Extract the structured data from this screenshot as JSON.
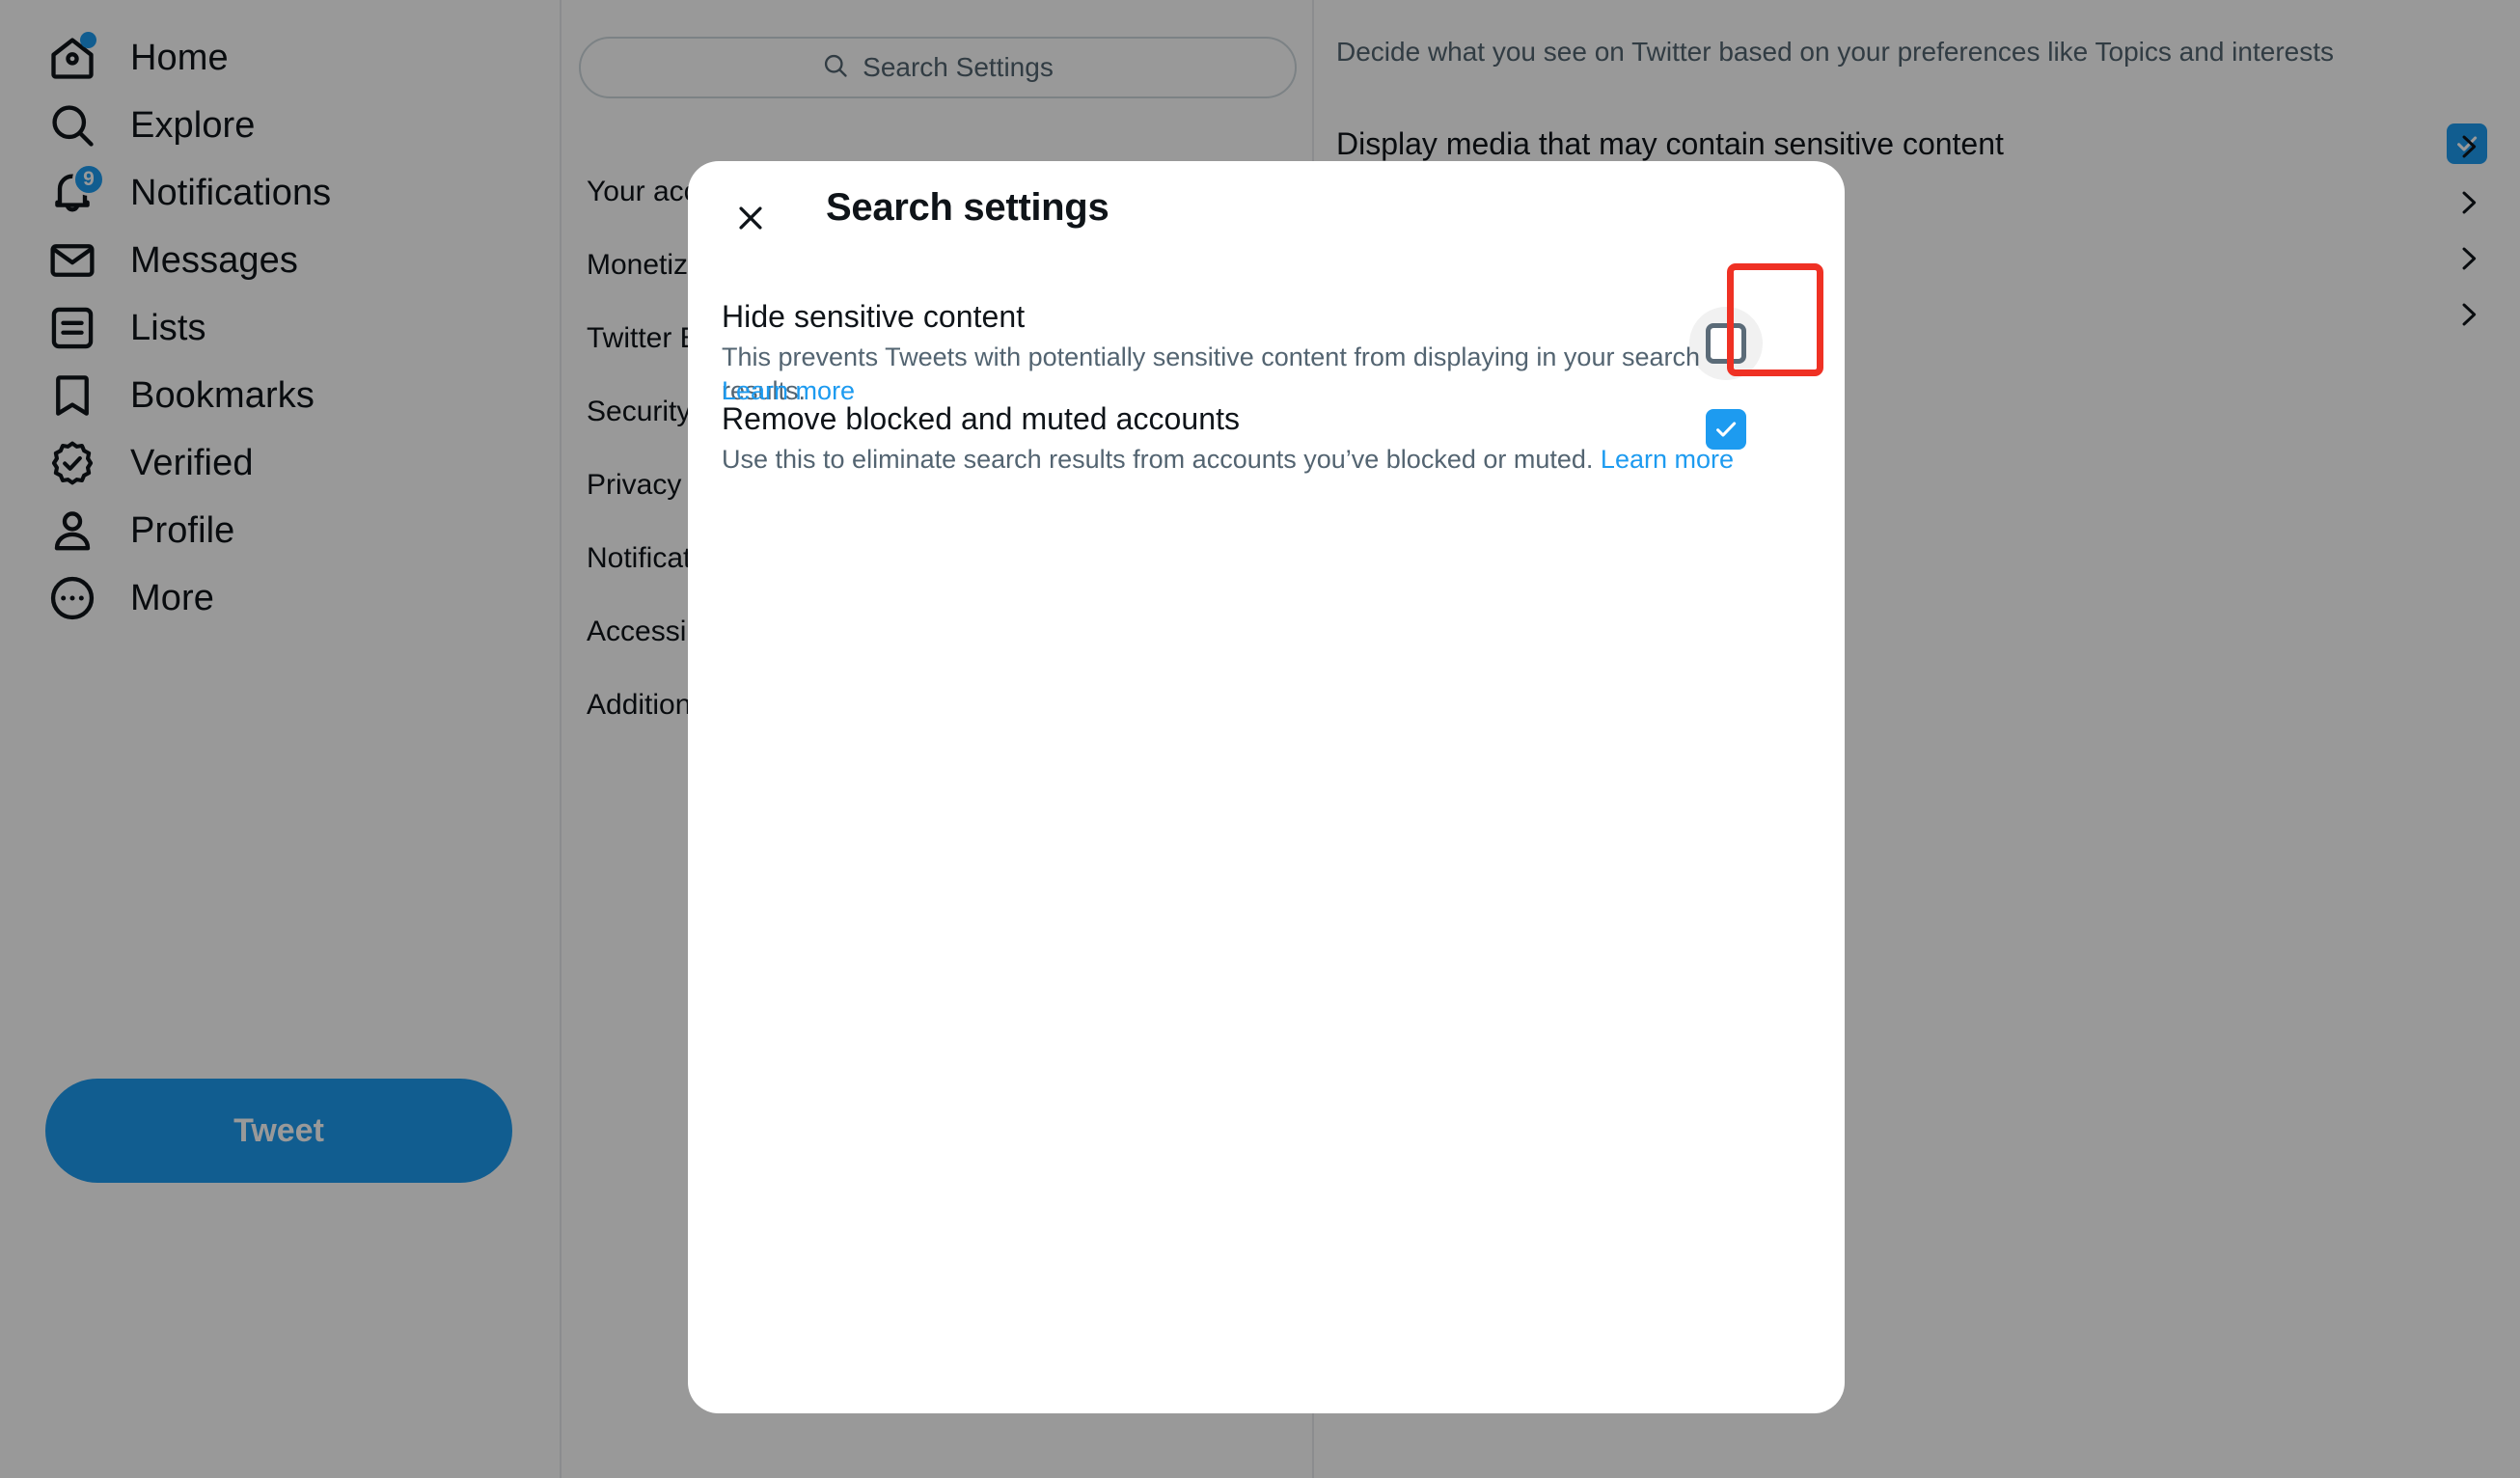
{
  "colors": {
    "brand_blue": "#1d9bf0",
    "text_primary": "#0f1419",
    "text_secondary": "#536471",
    "annotation_red": "#ef3124",
    "checkbox_outline": "#5b6b78"
  },
  "sidebar": {
    "items": [
      {
        "label": "Home",
        "icon": "home-icon",
        "badge": null,
        "dot": true
      },
      {
        "label": "Explore",
        "icon": "search-icon",
        "badge": null,
        "dot": false
      },
      {
        "label": "Notifications",
        "icon": "bell-icon",
        "badge": "9",
        "dot": false
      },
      {
        "label": "Messages",
        "icon": "envelope-icon",
        "badge": null,
        "dot": false
      },
      {
        "label": "Lists",
        "icon": "list-icon",
        "badge": null,
        "dot": false
      },
      {
        "label": "Bookmarks",
        "icon": "bookmark-icon",
        "badge": null,
        "dot": false
      },
      {
        "label": "Verified",
        "icon": "verified-badge-icon",
        "badge": null,
        "dot": false
      },
      {
        "label": "Profile",
        "icon": "person-icon",
        "badge": null,
        "dot": false
      },
      {
        "label": "More",
        "icon": "more-ellipsis-icon",
        "badge": null,
        "dot": false
      }
    ],
    "tweet_button_label": "Tweet"
  },
  "settings_column": {
    "search": {
      "placeholder": "Search Settings",
      "value": "",
      "icon": "search-icon"
    },
    "nav_items": [
      {
        "label": "Your account"
      },
      {
        "label": "Monetization"
      },
      {
        "label": "Twitter Blue"
      },
      {
        "label": "Security and account access"
      },
      {
        "label": "Privacy and safety"
      },
      {
        "label": "Notifications"
      },
      {
        "label": "Accessibility, display, and languages"
      },
      {
        "label": "Additional resources"
      }
    ]
  },
  "detail_column": {
    "description": "Decide what you see on Twitter based on your preferences like Topics and interests",
    "main_row": {
      "label": "Display media that may contain sensitive content",
      "checkbox_checked": true,
      "checkbox_icon": "checkmark-icon"
    },
    "chevrons": [
      {
        "icon": "chevron-right-icon"
      },
      {
        "icon": "chevron-right-icon"
      },
      {
        "icon": "chevron-right-icon"
      },
      {
        "icon": "chevron-right-icon"
      }
    ]
  },
  "modal": {
    "title": "Search settings",
    "close_icon": "close-x-icon",
    "rows": [
      {
        "title": "Hide sensitive content",
        "description": "This prevents Tweets with potentially sensitive content from displaying in your search results.",
        "link_label": "Learn more",
        "checkbox_checked": false,
        "highlighted": true
      },
      {
        "title": "Remove blocked and muted accounts",
        "description": "Use this to eliminate search results from accounts you’ve blocked or muted. ",
        "link_label": "Learn more",
        "checkbox_checked": true,
        "checkbox_icon": "checkmark-icon",
        "highlighted": false
      }
    ]
  }
}
